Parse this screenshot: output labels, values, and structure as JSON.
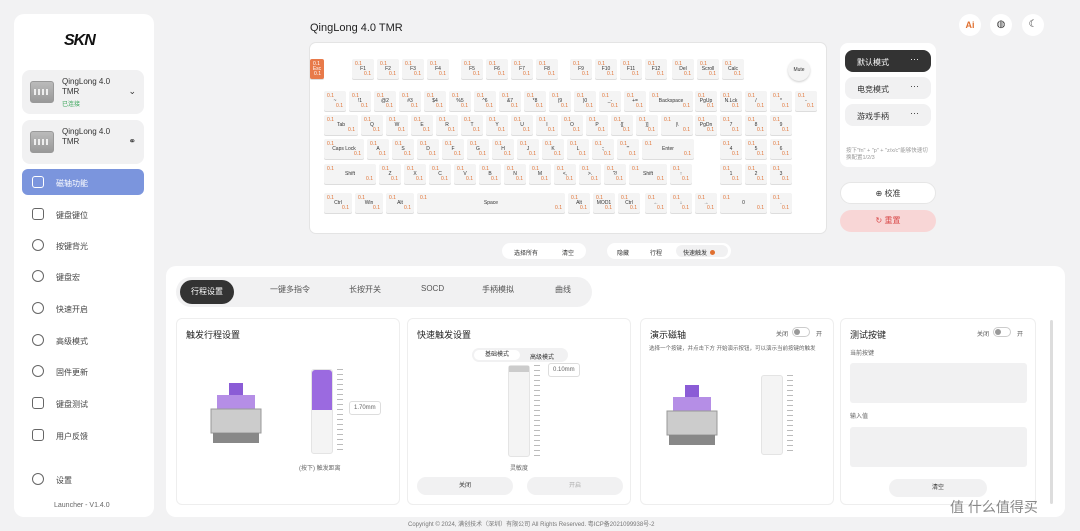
{
  "sidebar": {
    "logo": "SKN",
    "devices": [
      {
        "name": "QingLong 4.0 TMR",
        "status": "已连接"
      },
      {
        "name": "QingLong 4.0 TMR",
        "status": ""
      }
    ],
    "menu": [
      "磁轴功能",
      "键盘键位",
      "按键背光",
      "键盘宏",
      "快速开启",
      "高级模式",
      "固件更新",
      "键盘测试",
      "用户反馈"
    ],
    "settings": "设置",
    "version": "Launcher - V1.4.0"
  },
  "header": {
    "title": "QingLong 4.0 TMR"
  },
  "top_icons": [
    "ai-icon",
    "globe-icon",
    "moon-icon"
  ],
  "keyboard": {
    "value": "0.1",
    "mute": "Mute",
    "rows": [
      [
        [
          "Esc",
          0,
          14
        ],
        [
          "F1",
          42,
          22
        ],
        [
          "F2",
          67,
          22
        ],
        [
          "F3",
          92,
          22
        ],
        [
          "F4",
          117,
          22
        ],
        [
          "F5",
          151,
          22
        ],
        [
          "F6",
          176,
          22
        ],
        [
          "F7",
          201,
          22
        ],
        [
          "F8",
          226,
          22
        ],
        [
          "F9",
          260,
          22
        ],
        [
          "F10",
          285,
          22
        ],
        [
          "F11",
          310,
          22
        ],
        [
          "F12",
          335,
          22
        ],
        [
          "Del",
          362,
          22
        ],
        [
          "Scroll",
          387,
          22
        ],
        [
          "Calc",
          412,
          22
        ]
      ],
      [
        [
          "~",
          14,
          22
        ],
        [
          "!1",
          39,
          22
        ],
        [
          "@2",
          64,
          22
        ],
        [
          "#3",
          89,
          22
        ],
        [
          "$4",
          114,
          22
        ],
        [
          "%5",
          139,
          22
        ],
        [
          "^6",
          164,
          22
        ],
        [
          "&7",
          189,
          22
        ],
        [
          "*8",
          214,
          22
        ],
        [
          "(9",
          239,
          22
        ],
        [
          ")0",
          264,
          22
        ],
        [
          "_-",
          289,
          22
        ],
        [
          "+=",
          314,
          22
        ],
        [
          "Backspace",
          339,
          44
        ],
        [
          "PgUp",
          385,
          22
        ],
        [
          "N.Lck",
          410,
          22
        ],
        [
          "/",
          435,
          22
        ],
        [
          "*",
          460,
          22
        ],
        [
          "-",
          485,
          22
        ]
      ],
      [
        [
          "Tab",
          14,
          34
        ],
        [
          "Q",
          51,
          22
        ],
        [
          "W",
          76,
          22
        ],
        [
          "E",
          101,
          22
        ],
        [
          "R",
          126,
          22
        ],
        [
          "T",
          151,
          22
        ],
        [
          "Y",
          176,
          22
        ],
        [
          "U",
          201,
          22
        ],
        [
          "I",
          226,
          22
        ],
        [
          "O",
          251,
          22
        ],
        [
          "P",
          276,
          22
        ],
        [
          "{[",
          301,
          22
        ],
        [
          "}]",
          326,
          22
        ],
        [
          "|\\",
          351,
          32
        ],
        [
          "PgDn",
          385,
          22
        ],
        [
          "7",
          410,
          22
        ],
        [
          "8",
          435,
          22
        ],
        [
          "9",
          460,
          22
        ]
      ],
      [
        [
          "Caps Lock",
          14,
          40
        ],
        [
          "A",
          57,
          22
        ],
        [
          "S",
          82,
          22
        ],
        [
          "D",
          107,
          22
        ],
        [
          "F",
          132,
          22
        ],
        [
          "G",
          157,
          22
        ],
        [
          "H",
          182,
          22
        ],
        [
          "J",
          207,
          22
        ],
        [
          "K",
          232,
          22
        ],
        [
          "L",
          257,
          22
        ],
        [
          ":;",
          282,
          22
        ],
        [
          "\"'",
          307,
          22
        ],
        [
          "Enter",
          332,
          52
        ],
        [
          "4",
          410,
          22
        ],
        [
          "5",
          435,
          22
        ],
        [
          "6",
          460,
          22
        ]
      ],
      [
        [
          "Shift",
          14,
          52
        ],
        [
          "Z",
          69,
          22
        ],
        [
          "X",
          94,
          22
        ],
        [
          "C",
          119,
          22
        ],
        [
          "V",
          144,
          22
        ],
        [
          "B",
          169,
          22
        ],
        [
          "N",
          194,
          22
        ],
        [
          "M",
          219,
          22
        ],
        [
          "<,",
          244,
          22
        ],
        [
          ">.",
          269,
          22
        ],
        [
          "?/",
          294,
          22
        ],
        [
          "Shift",
          319,
          38
        ],
        [
          "↑",
          360,
          22
        ],
        [
          "1",
          410,
          22
        ],
        [
          "2",
          435,
          22
        ],
        [
          "3",
          460,
          22
        ]
      ],
      [
        [
          "Ctrl",
          14,
          28
        ],
        [
          "Win",
          45,
          28
        ],
        [
          "Alt",
          76,
          28
        ],
        [
          "Space",
          107,
          148
        ],
        [
          "Alt",
          258,
          22
        ],
        [
          "MOD1",
          283,
          22
        ],
        [
          "Ctrl",
          308,
          22
        ],
        [
          "←",
          335,
          22
        ],
        [
          "↓",
          360,
          22
        ],
        [
          "→",
          385,
          22
        ],
        [
          "0",
          410,
          47
        ],
        [
          ".",
          460,
          22
        ]
      ]
    ]
  },
  "modes": {
    "items": [
      "默认模式",
      "电竞模式",
      "游戏手柄"
    ],
    "hint": "按下\"fn\" + \"p\" + \"z/x/c\"能够快速切换配置1/2/3"
  },
  "calibrate": "校准",
  "reset": "重置",
  "select_pill": [
    "选择所有",
    "清空"
  ],
  "light_pill": [
    "隐藏",
    "行程",
    "快速触发"
  ],
  "tabs": [
    "行程设置",
    "一键多指令",
    "长按开关",
    "SOCD",
    "手柄模拟",
    "曲线"
  ],
  "card1": {
    "title": "触发行程设置",
    "value": "1.70mm",
    "caption": "(按下) 触发距离"
  },
  "card2": {
    "title": "快速触发设置",
    "modes": [
      "基础模式",
      "高级模式"
    ],
    "value": "0.10mm",
    "caption": "灵敏度",
    "off": "关闭",
    "on": "开启"
  },
  "card3": {
    "title": "演示磁轴",
    "toggle_off": "关闭",
    "toggle_on": "开",
    "desc": "选择一个按键，并点击下方 开始演示按钮，可以演示当前按键的触发"
  },
  "card4": {
    "title": "测试按键",
    "toggle_off": "关闭",
    "toggle_on": "开",
    "current": "当前按键",
    "input": "输入值",
    "clear": "清空"
  },
  "footer": "Copyright © 2024, 满创技术（深圳）有限公司 All Rights Reserved. 粤ICP备2021099938号-2",
  "watermark": "值 什么值得买"
}
